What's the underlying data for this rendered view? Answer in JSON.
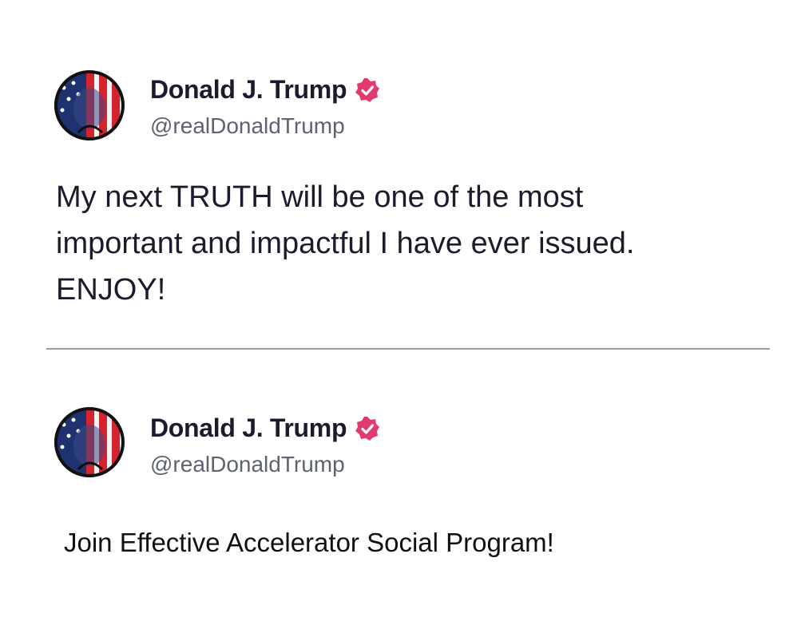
{
  "posts": [
    {
      "author": {
        "display_name": "Donald J. Trump",
        "handle": "@realDonaldTrump",
        "verified": true,
        "verified_color": "#e03a6e",
        "avatar_icon": "flag-portrait-avatar"
      },
      "text": "My next TRUTH will be one of the most\nimportant and impactful I have ever issued.\nENJOY!"
    },
    {
      "author": {
        "display_name": "Donald J. Trump",
        "handle": "@realDonaldTrump",
        "verified": true,
        "verified_color": "#e03a6e",
        "avatar_icon": "flag-portrait-avatar"
      },
      "text": "Join Effective Accelerator Social Program!"
    }
  ]
}
